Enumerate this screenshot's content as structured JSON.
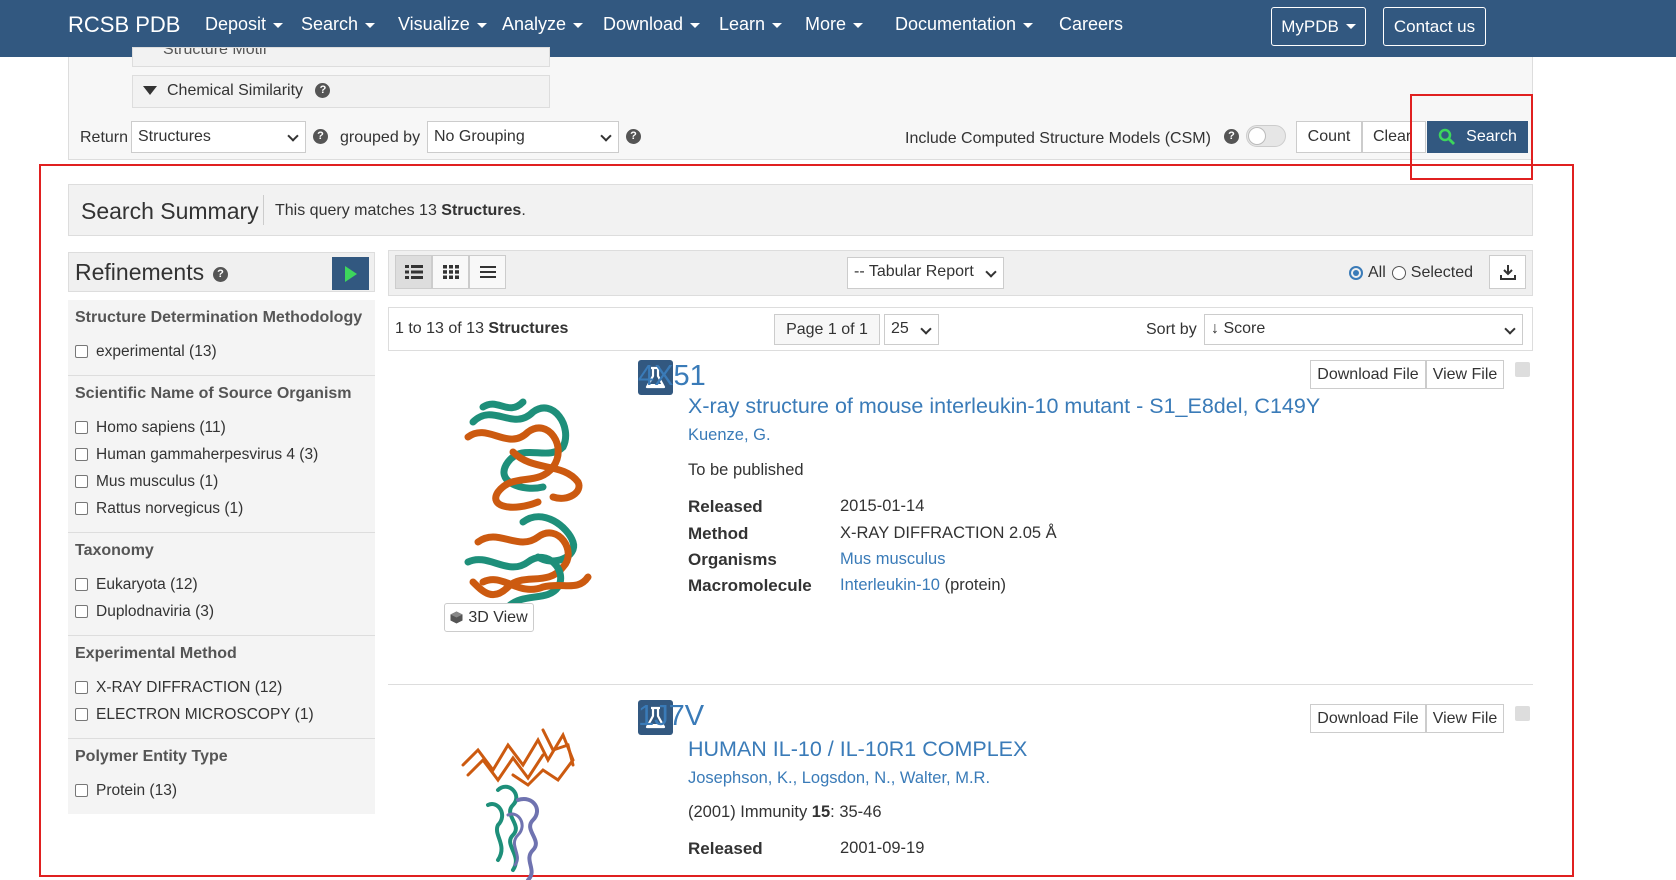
{
  "nav": {
    "brand": "RCSB PDB",
    "items": [
      {
        "label": "Deposit",
        "caret": true
      },
      {
        "label": "Search",
        "caret": true
      },
      {
        "label": "Visualize",
        "caret": true
      },
      {
        "label": "Analyze",
        "caret": true
      },
      {
        "label": "Download",
        "caret": true
      },
      {
        "label": "Learn",
        "caret": true
      },
      {
        "label": "More",
        "caret": true
      },
      {
        "label": "Documentation",
        "caret": true
      },
      {
        "label": "Careers",
        "caret": false
      }
    ],
    "mypdb": "MyPDB",
    "contact": "Contact us"
  },
  "panel": {
    "partial_item": "Structure Motif",
    "chemical_similarity": "Chemical Similarity",
    "return_label": "Return",
    "return_value": "Structures",
    "grouped_label": "grouped by",
    "grouped_value": "No Grouping",
    "csm_label": "Include Computed Structure Models (CSM)",
    "count": "Count",
    "clear": "Clear",
    "search": "Search"
  },
  "summary": {
    "title": "Search Summary",
    "prefix": "This query matches 13 ",
    "bold": "Structures",
    "suffix": "."
  },
  "refinements": {
    "title": "Refinements",
    "groups": [
      {
        "title": "Structure Determination Methodology",
        "items": [
          "experimental (13)"
        ]
      },
      {
        "title": "Scientific Name of Source Organism",
        "items": [
          "Homo sapiens (11)",
          "Human gammaherpesvirus 4 (3)",
          "Mus musculus (1)",
          "Rattus norvegicus (1)"
        ]
      },
      {
        "title": "Taxonomy",
        "items": [
          "Eukaryota (12)",
          "Duplodnaviria (3)"
        ]
      },
      {
        "title": "Experimental Method",
        "items": [
          "X-RAY DIFFRACTION (12)",
          "ELECTRON MICROSCOPY (1)"
        ]
      },
      {
        "title": "Polymer Entity Type",
        "items": [
          "Protein (13)"
        ]
      }
    ]
  },
  "toolbar": {
    "report": "-- Tabular Report",
    "all": "All",
    "selected": "Selected"
  },
  "paging": {
    "range_prefix": "1 to 13 of 13 ",
    "range_bold": "Structures",
    "page": "Page 1 of 1",
    "per_page": "25",
    "sort_label": "Sort by",
    "sort_value": "↓ Score"
  },
  "results": [
    {
      "accession": "4X51",
      "title": "X-ray structure of mouse interleukin-10 mutant - S1_E8del, C149Y",
      "authors": "Kuenze, G.",
      "citation": "To be published",
      "released": "2015-01-14",
      "method": "X-RAY DIFFRACTION 2.05 Å",
      "organism": "Mus musculus",
      "macromolecule": "Interleukin-10",
      "macromolecule_suffix": " (protein)",
      "view3d": "3D View"
    },
    {
      "accession": "1J7V",
      "title": "HUMAN IL-10 / IL-10R1 COMPLEX",
      "authors": [
        "Josephson, K.",
        "Logsdon, N.",
        "Walter, M.R."
      ],
      "citation_prefix": "(2001) Immunity ",
      "citation_bold": "15",
      "citation_suffix": ": 35-46",
      "released": "2001-09-19"
    }
  ],
  "field_labels": {
    "released": "Released",
    "method": "Method",
    "organisms": "Organisms",
    "macromolecule": "Macromolecule"
  },
  "result_buttons": {
    "download": "Download File",
    "view": "View File"
  },
  "colors": {
    "nav": "#325880",
    "link": "#3a7bb8",
    "highlight": "#e02020",
    "search_icon": "#3dd65c",
    "protein_orange": "#cc5a10",
    "protein_teal": "#1e8f7a",
    "protein_blue": "#6f73b0"
  }
}
